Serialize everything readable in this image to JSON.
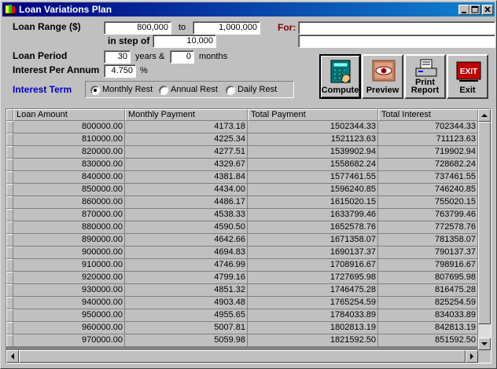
{
  "window": {
    "title": "Loan Variations Plan"
  },
  "form": {
    "loan_range_label": "Loan Range ($)",
    "from_value": "800,000",
    "to_label": "to",
    "to_value": "1,000,000",
    "for_label": "For:",
    "for_line1": "",
    "for_line2": "",
    "step_label": "in step of",
    "step_value": "10,000",
    "period_label": "Loan Period",
    "years_value": "30",
    "years_label": "years &",
    "months_value": "0",
    "months_label": "months",
    "interest_label": "Interest Per Annum",
    "interest_value": "4.750",
    "percent_label": "%",
    "interest_term_label": "Interest Term",
    "radios": [
      {
        "label": "Monthly Rest",
        "selected": true
      },
      {
        "label": "Annual Rest",
        "selected": false
      },
      {
        "label": "Daily Rest",
        "selected": false
      }
    ]
  },
  "buttons": {
    "compute": "Compute",
    "preview": "Preview",
    "print_line1": "Print",
    "print_line2": "Report",
    "exit": "Exit",
    "exit_icon_text": "EXIT"
  },
  "table": {
    "columns": [
      "Loan Amount",
      "Monthly Payment",
      "Total Payment",
      "Total Interest"
    ],
    "rows": [
      [
        "800000.00",
        "4173.18",
        "1502344.33",
        "702344.33"
      ],
      [
        "810000.00",
        "4225.34",
        "1521123.63",
        "711123.63"
      ],
      [
        "820000.00",
        "4277.51",
        "1539902.94",
        "719902.94"
      ],
      [
        "830000.00",
        "4329.67",
        "1558682.24",
        "728682.24"
      ],
      [
        "840000.00",
        "4381.84",
        "1577461.55",
        "737461.55"
      ],
      [
        "850000.00",
        "4434.00",
        "1596240.85",
        "746240.85"
      ],
      [
        "860000.00",
        "4486.17",
        "1615020.15",
        "755020.15"
      ],
      [
        "870000.00",
        "4538.33",
        "1633799.46",
        "763799.46"
      ],
      [
        "880000.00",
        "4590.50",
        "1652578.76",
        "772578.76"
      ],
      [
        "890000.00",
        "4642.66",
        "1671358.07",
        "781358.07"
      ],
      [
        "900000.00",
        "4694.83",
        "1690137.37",
        "790137.37"
      ],
      [
        "910000.00",
        "4746.99",
        "1708916.67",
        "798916.67"
      ],
      [
        "920000.00",
        "4799.16",
        "1727695.98",
        "807695.98"
      ],
      [
        "930000.00",
        "4851.32",
        "1746475.28",
        "816475.28"
      ],
      [
        "940000.00",
        "4903.48",
        "1765254.59",
        "825254.59"
      ],
      [
        "950000.00",
        "4955.65",
        "1784033.89",
        "834033.89"
      ],
      [
        "960000.00",
        "5007.81",
        "1802813.19",
        "842813.19"
      ],
      [
        "970000.00",
        "5059.98",
        "1821592.50",
        "851592.50"
      ]
    ]
  },
  "colors": {
    "for_label": "#800000",
    "interest_term": "#0000c0",
    "title_bar": "#000080"
  }
}
